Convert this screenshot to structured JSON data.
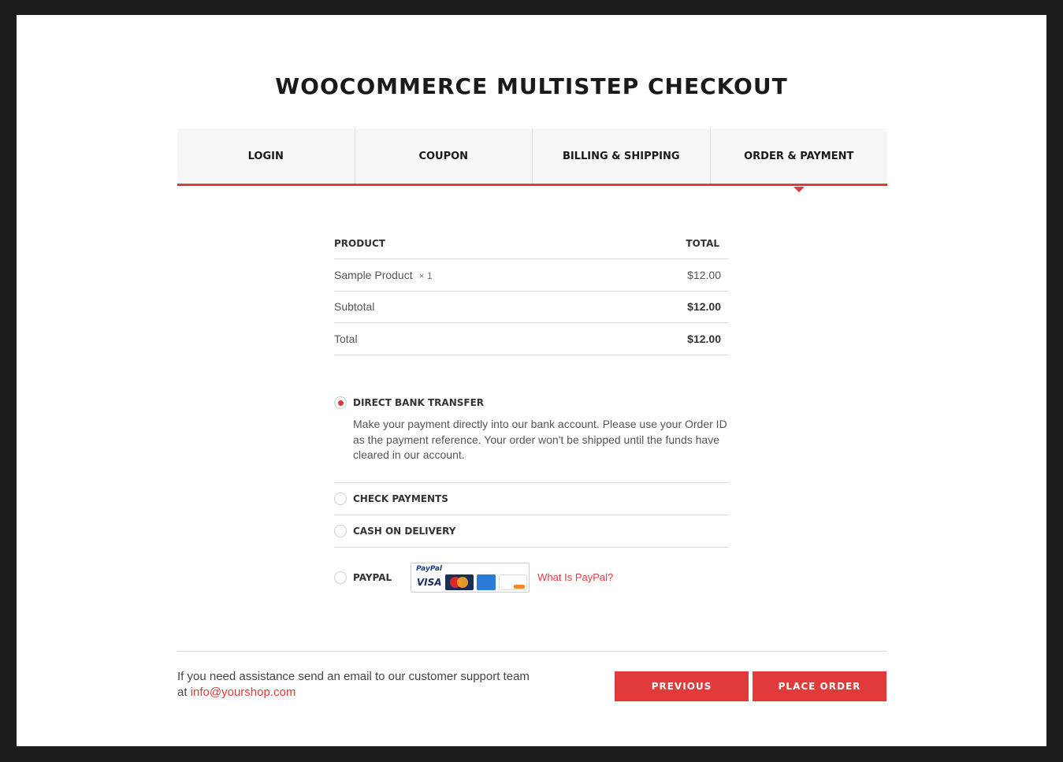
{
  "page": {
    "title": "WOOCOMMERCE MULTISTEP CHECKOUT"
  },
  "steps": [
    {
      "label": "LOGIN",
      "active": false
    },
    {
      "label": "COUPON",
      "active": false
    },
    {
      "label": "BILLING & SHIPPING",
      "active": false
    },
    {
      "label": "ORDER & PAYMENT",
      "active": true
    }
  ],
  "order": {
    "headers": {
      "product": "PRODUCT",
      "total": "TOTAL"
    },
    "items": [
      {
        "name": "Sample Product",
        "qty": "× 1",
        "total": "$12.00"
      }
    ],
    "subtotal": {
      "label": "Subtotal",
      "value": "$12.00"
    },
    "total": {
      "label": "Total",
      "value": "$12.00"
    }
  },
  "payment": {
    "methods": [
      {
        "label": "DIRECT BANK TRANSFER",
        "selected": true,
        "description": "Make your payment directly into our bank account. Please use your Order ID as the payment reference. Your order won't be shipped until the funds have cleared in our account."
      },
      {
        "label": "CHECK PAYMENTS",
        "selected": false
      },
      {
        "label": "CASH ON DELIVERY",
        "selected": false
      },
      {
        "label": "PAYPAL",
        "selected": false,
        "link": "What Is PayPal?"
      }
    ],
    "paypal_cards": {
      "brand": "PayPal",
      "visa": "VISA",
      "mastercard": "MasterCard",
      "amex": "AMERICAN EXPRESS",
      "discover": "DISCOVER"
    }
  },
  "footer": {
    "help_text": "If you need assistance send an email to our customer support team at",
    "email": "info@yourshop.com",
    "previous_label": "PREVIOUS",
    "place_order_label": "PLACE ORDER"
  },
  "colors": {
    "accent": "#e03a3a",
    "frame_bg": "#1c1c1c",
    "tab_bg": "#f7f7f7"
  }
}
